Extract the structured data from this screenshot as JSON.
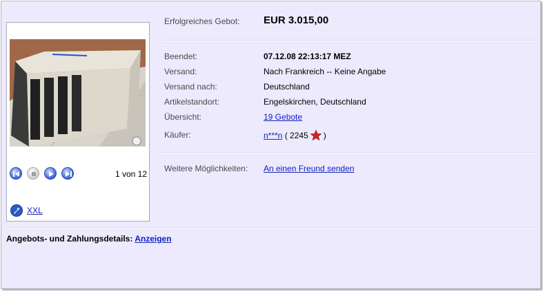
{
  "price": {
    "label": "Erfolgreiches Gebot:",
    "value": "EUR 3.015,00"
  },
  "details": [
    {
      "key": "ended",
      "label": "Beendet:",
      "value": "07.12.08 22:13:17 MEZ"
    },
    {
      "key": "shipping",
      "label": "Versand:",
      "value": "Nach Frankreich -- Keine Angabe"
    },
    {
      "key": "ship_to",
      "label": "Versand nach:",
      "value": "Deutschland"
    },
    {
      "key": "location",
      "label": "Artikelstandort:",
      "value": "Engelskirchen, Deutschland"
    },
    {
      "key": "overview",
      "label": "Übersicht:",
      "value": "19 Gebote"
    }
  ],
  "buyer": {
    "label": "Käufer:",
    "name": "n***n",
    "open": "(",
    "rating": "2245",
    "close": ")",
    "star_color": "#e02020"
  },
  "more": {
    "label": "Weitere Möglichkeiten:",
    "link": "An einen Freund senden"
  },
  "gallery": {
    "counter": "1 von 12",
    "xxl_label": "XXL"
  },
  "footer": {
    "label": "Angebots- und Zahlungsdetails:",
    "link": "Anzeigen"
  },
  "colors": {
    "link": "#1020c0",
    "panel_bg": "#eceafc"
  },
  "icons": {
    "prev": "skip-back-icon",
    "stop": "stop-icon",
    "play": "play-icon",
    "next": "skip-forward-icon",
    "zoom": "zoom-arrow-icon",
    "rating": "star-icon"
  }
}
